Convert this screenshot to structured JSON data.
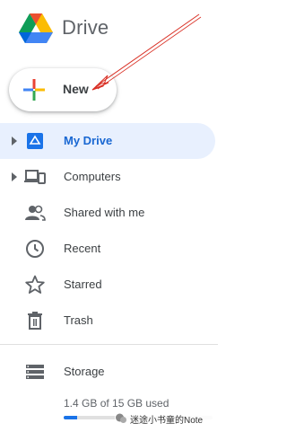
{
  "header": {
    "brand": "Drive"
  },
  "new_button": {
    "label": "New"
  },
  "nav": {
    "items": [
      {
        "label": "My Drive",
        "icon": "my-drive-icon",
        "active": true,
        "expandable": true
      },
      {
        "label": "Computers",
        "icon": "computers-icon",
        "active": false,
        "expandable": true
      },
      {
        "label": "Shared with me",
        "icon": "shared-with-me-icon",
        "active": false,
        "expandable": false
      },
      {
        "label": "Recent",
        "icon": "clock-icon",
        "active": false,
        "expandable": false
      },
      {
        "label": "Starred",
        "icon": "star-icon",
        "active": false,
        "expandable": false
      },
      {
        "label": "Trash",
        "icon": "trash-icon",
        "active": false,
        "expandable": false
      }
    ]
  },
  "storage": {
    "label": "Storage",
    "usage_text": "1.4 GB of 15 GB used",
    "used_fraction": 0.093
  },
  "watermark": {
    "text": "迷途小书童的Note"
  },
  "colors": {
    "accent": "#1a73e8",
    "active_bg": "#e8f0fe",
    "active_text": "#1967d2",
    "annotation": "#d93025"
  }
}
